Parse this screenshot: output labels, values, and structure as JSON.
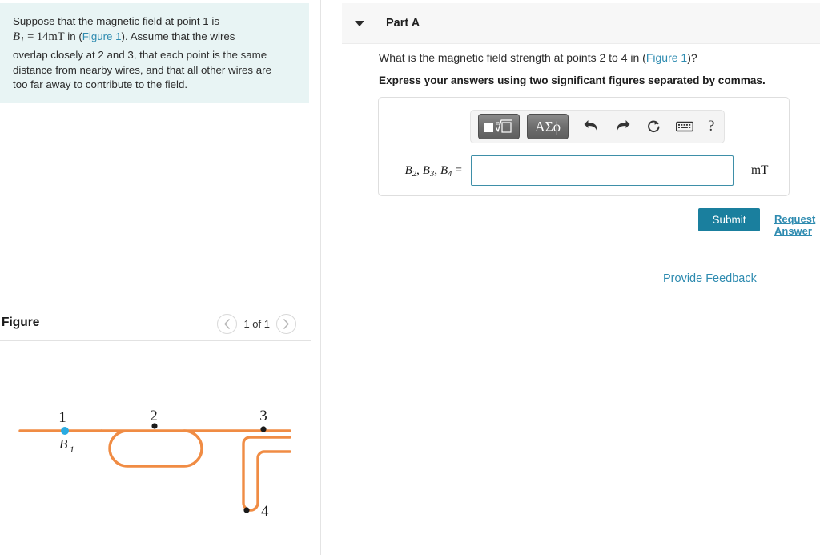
{
  "problem": {
    "line1_pre": "Suppose that the magnetic field at point 1 is",
    "sym_B": "B",
    "sym_B_sub": "1",
    "eq": "= 14",
    "unit": "mT",
    "in_word": "in (",
    "figure_link": "Figure 1",
    "after_link": "). Assume that the wires",
    "line3": "overlap closely at 2 and 3, that each point is the same",
    "line4": "distance from nearby wires, and that all other wires are",
    "line5": "too far away to contribute to the field."
  },
  "figure": {
    "title": "Figure",
    "counter": "1 of 1",
    "prev_icon": "chevron-left-icon",
    "next_icon": "chevron-right-icon",
    "wire_color": "#f08c44",
    "point1_color": "#29abe2",
    "point_color": "#1a1a1a",
    "labels": {
      "p1": "1",
      "p2": "2",
      "p3": "3",
      "p4": "4",
      "field": "B",
      "field_sub": "1"
    }
  },
  "parta": {
    "caret_icon": "caret-down-icon",
    "title": "Part A",
    "question_pre": "What is the magnetic field strength at points 2 to 4 in (",
    "question_link": "Figure 1",
    "question_post": ")?",
    "instruction": "Express your answers using two significant figures separated by commas."
  },
  "toolbar": {
    "template_button": "template-radical-button",
    "greek_button": "ΑΣϕ",
    "undo_icon": "undo-arrow-icon",
    "redo_icon": "redo-arrow-icon",
    "reset_icon": "reset-circular-arrow-icon",
    "keyboard_icon": "keyboard-icon",
    "help_label": "?"
  },
  "answer": {
    "label_b": "B",
    "label": "B₂, B₃, B₄ =",
    "value": "",
    "placeholder": "",
    "unit": "mT"
  },
  "actions": {
    "submit": "Submit",
    "request_answer": "Request Answer",
    "provide_feedback": "Provide Feedback"
  },
  "colors": {
    "accent_teal": "#1a7f9e",
    "link_blue": "#2e8bb0",
    "problem_bg": "#e8f4f4",
    "wire_orange": "#f08c44"
  }
}
